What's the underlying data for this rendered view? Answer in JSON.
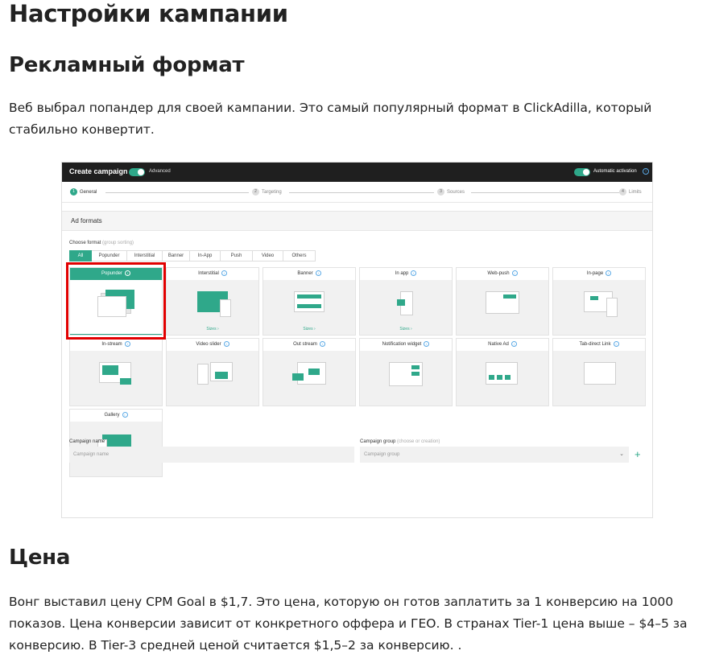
{
  "article": {
    "h1": "Настройки кампании",
    "h2_format": "Рекламный формат",
    "p1": "Веб выбрал попандер для своей кампании. Это самый популярный формат в ClickAdilla, который стабильно конвертит.",
    "h2_price": "Цена",
    "p2": "Вонг выставил цену CPM Goal в $1,7. Это цена, которую он готов заплатить за 1 конверсию на 1000 показов. Цена конверсии зависит от конкретного оффера и  ГЕО. В странах Tier-1 цена выше – $4–5 за конверсию. В Tier-3 средней ценой считается $1,5–2 за конверсию. ."
  },
  "app": {
    "title": "Create campaign",
    "advanced": "Advanced",
    "auto_activation": "Automatic activation",
    "info": "i",
    "steps": [
      {
        "num": "1",
        "label": "General"
      },
      {
        "num": "2",
        "label": "Targeting"
      },
      {
        "num": "3",
        "label": "Sources"
      },
      {
        "num": "4",
        "label": "Limits"
      }
    ],
    "panel_title": "Ad formats",
    "choose_label": "Choose format",
    "choose_hint": "(group sorting)",
    "tabs": [
      "All",
      "Popunder",
      "Interstitial",
      "Banner",
      "In-App",
      "Push",
      "Video",
      "Others"
    ],
    "formats": [
      {
        "name": "Popunder",
        "sizes": "",
        "selected": true
      },
      {
        "name": "Interstitial",
        "sizes": "Sizes ›"
      },
      {
        "name": "Banner",
        "sizes": "Sizes ›"
      },
      {
        "name": "In app",
        "sizes": "Sizes ›"
      },
      {
        "name": "Web-push",
        "sizes": ""
      },
      {
        "name": "In-page",
        "sizes": ""
      },
      {
        "name": "In-stream",
        "sizes": ""
      },
      {
        "name": "Video slider",
        "sizes": ""
      },
      {
        "name": "Out stream",
        "sizes": ""
      },
      {
        "name": "Notification widget",
        "sizes": ""
      },
      {
        "name": "Native Ad",
        "sizes": ""
      },
      {
        "name": "Tab-direct Link",
        "sizes": ""
      },
      {
        "name": "Gallery",
        "sizes": ""
      }
    ],
    "campaign_name_label": "Campaign name",
    "campaign_name_placeholder": "Campaign name",
    "campaign_group_label": "Campaign group",
    "campaign_group_hint": "(choose or creation)",
    "campaign_group_placeholder": "Campaign group",
    "chevron": "⌄",
    "plus": "+"
  },
  "colors": {
    "accent": "#2fa88a",
    "highlight": "#e10000",
    "topbar": "#1f1f1f"
  }
}
